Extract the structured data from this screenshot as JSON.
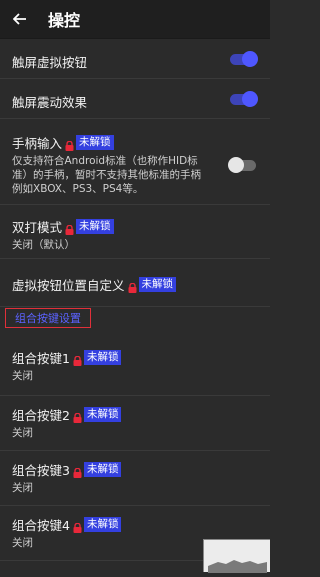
{
  "appbar": {
    "title": "操控"
  },
  "lock_badge": "未解锁",
  "rows": {
    "touch_buttons": {
      "label": "触屏虚拟按钮",
      "toggle_on": true
    },
    "touch_vibration": {
      "label": "触屏震动效果",
      "toggle_on": true
    },
    "gamepad": {
      "label": "手柄输入",
      "desc1": "仅支持符合Android标准（也称作HID标",
      "desc2": "准）的手柄，暂时不支持其他标准的手柄",
      "desc3": "例如XBOX、PS3、PS4等。",
      "toggle_on": false
    },
    "double_tap": {
      "label": "双打模式",
      "sub": "关闭（默认）"
    },
    "custom_pos": {
      "label": "虚拟按钮位置自定义"
    }
  },
  "section": {
    "label": "组合按键设置"
  },
  "combos": [
    {
      "label": "组合按键1",
      "sub": "关闭"
    },
    {
      "label": "组合按键2",
      "sub": "关闭"
    },
    {
      "label": "组合按键3",
      "sub": "关闭"
    },
    {
      "label": "组合按键4",
      "sub": "关闭"
    }
  ],
  "colors": {
    "accent": "#4f57ff",
    "badge": "#3440e0",
    "lock": "#e8283a",
    "section_border": "#e0303a"
  }
}
